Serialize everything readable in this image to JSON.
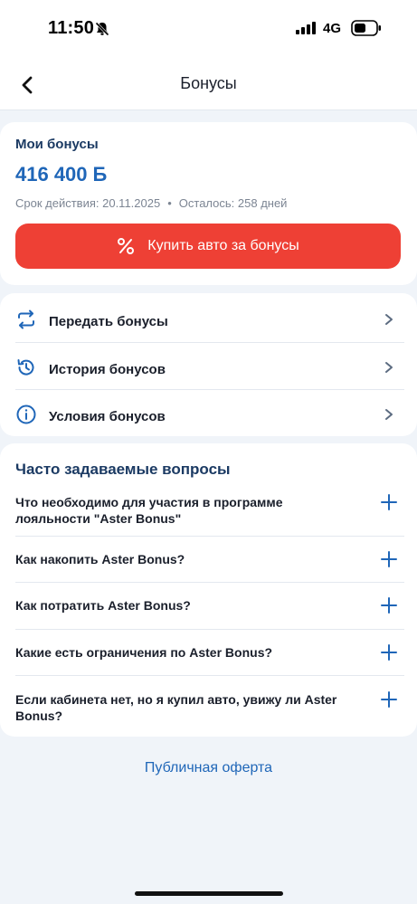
{
  "status_bar": {
    "time": "11:50",
    "network": "4G",
    "icons": [
      "bell-off-icon",
      "signal-icon",
      "battery-icon"
    ]
  },
  "header": {
    "title": "Бонусы",
    "back_icon": "chevron-left-icon"
  },
  "bonus_card": {
    "label": "Мои бонусы",
    "amount": "416 400",
    "currency_symbol": "Б",
    "validity_label": "Срок действия: 20.11.2025",
    "separator": "•",
    "remaining_label": "Осталось: 258 дней",
    "buy_button": {
      "label": "Купить авто за бонусы",
      "icon": "percent-icon",
      "color": "#ee4035"
    }
  },
  "menu": {
    "items": [
      {
        "label": "Передать бонусы",
        "icon": "transfer-icon"
      },
      {
        "label": "История бонусов",
        "icon": "history-icon"
      },
      {
        "label": "Условия бонусов",
        "icon": "info-icon"
      }
    ]
  },
  "faq": {
    "title": "Часто задаваемые вопросы",
    "items": [
      {
        "question": "Что необходимо для участия в программе лояльности \"Aster Bonus\""
      },
      {
        "question": "Как накопить Aster Bonus?"
      },
      {
        "question": "Как потратить Aster Bonus?"
      },
      {
        "question": "Какие есть ограничения по Aster Bonus?"
      },
      {
        "question": "Если кабинета нет, но я купил авто, увижу ли Aster Bonus?"
      }
    ]
  },
  "footer": {
    "public_offer": "Публичная оферта"
  },
  "colors": {
    "accent_blue": "#1f66b8",
    "title_navy": "#1b3a63",
    "danger_red": "#ee4035",
    "background": "#f0f4f9"
  }
}
